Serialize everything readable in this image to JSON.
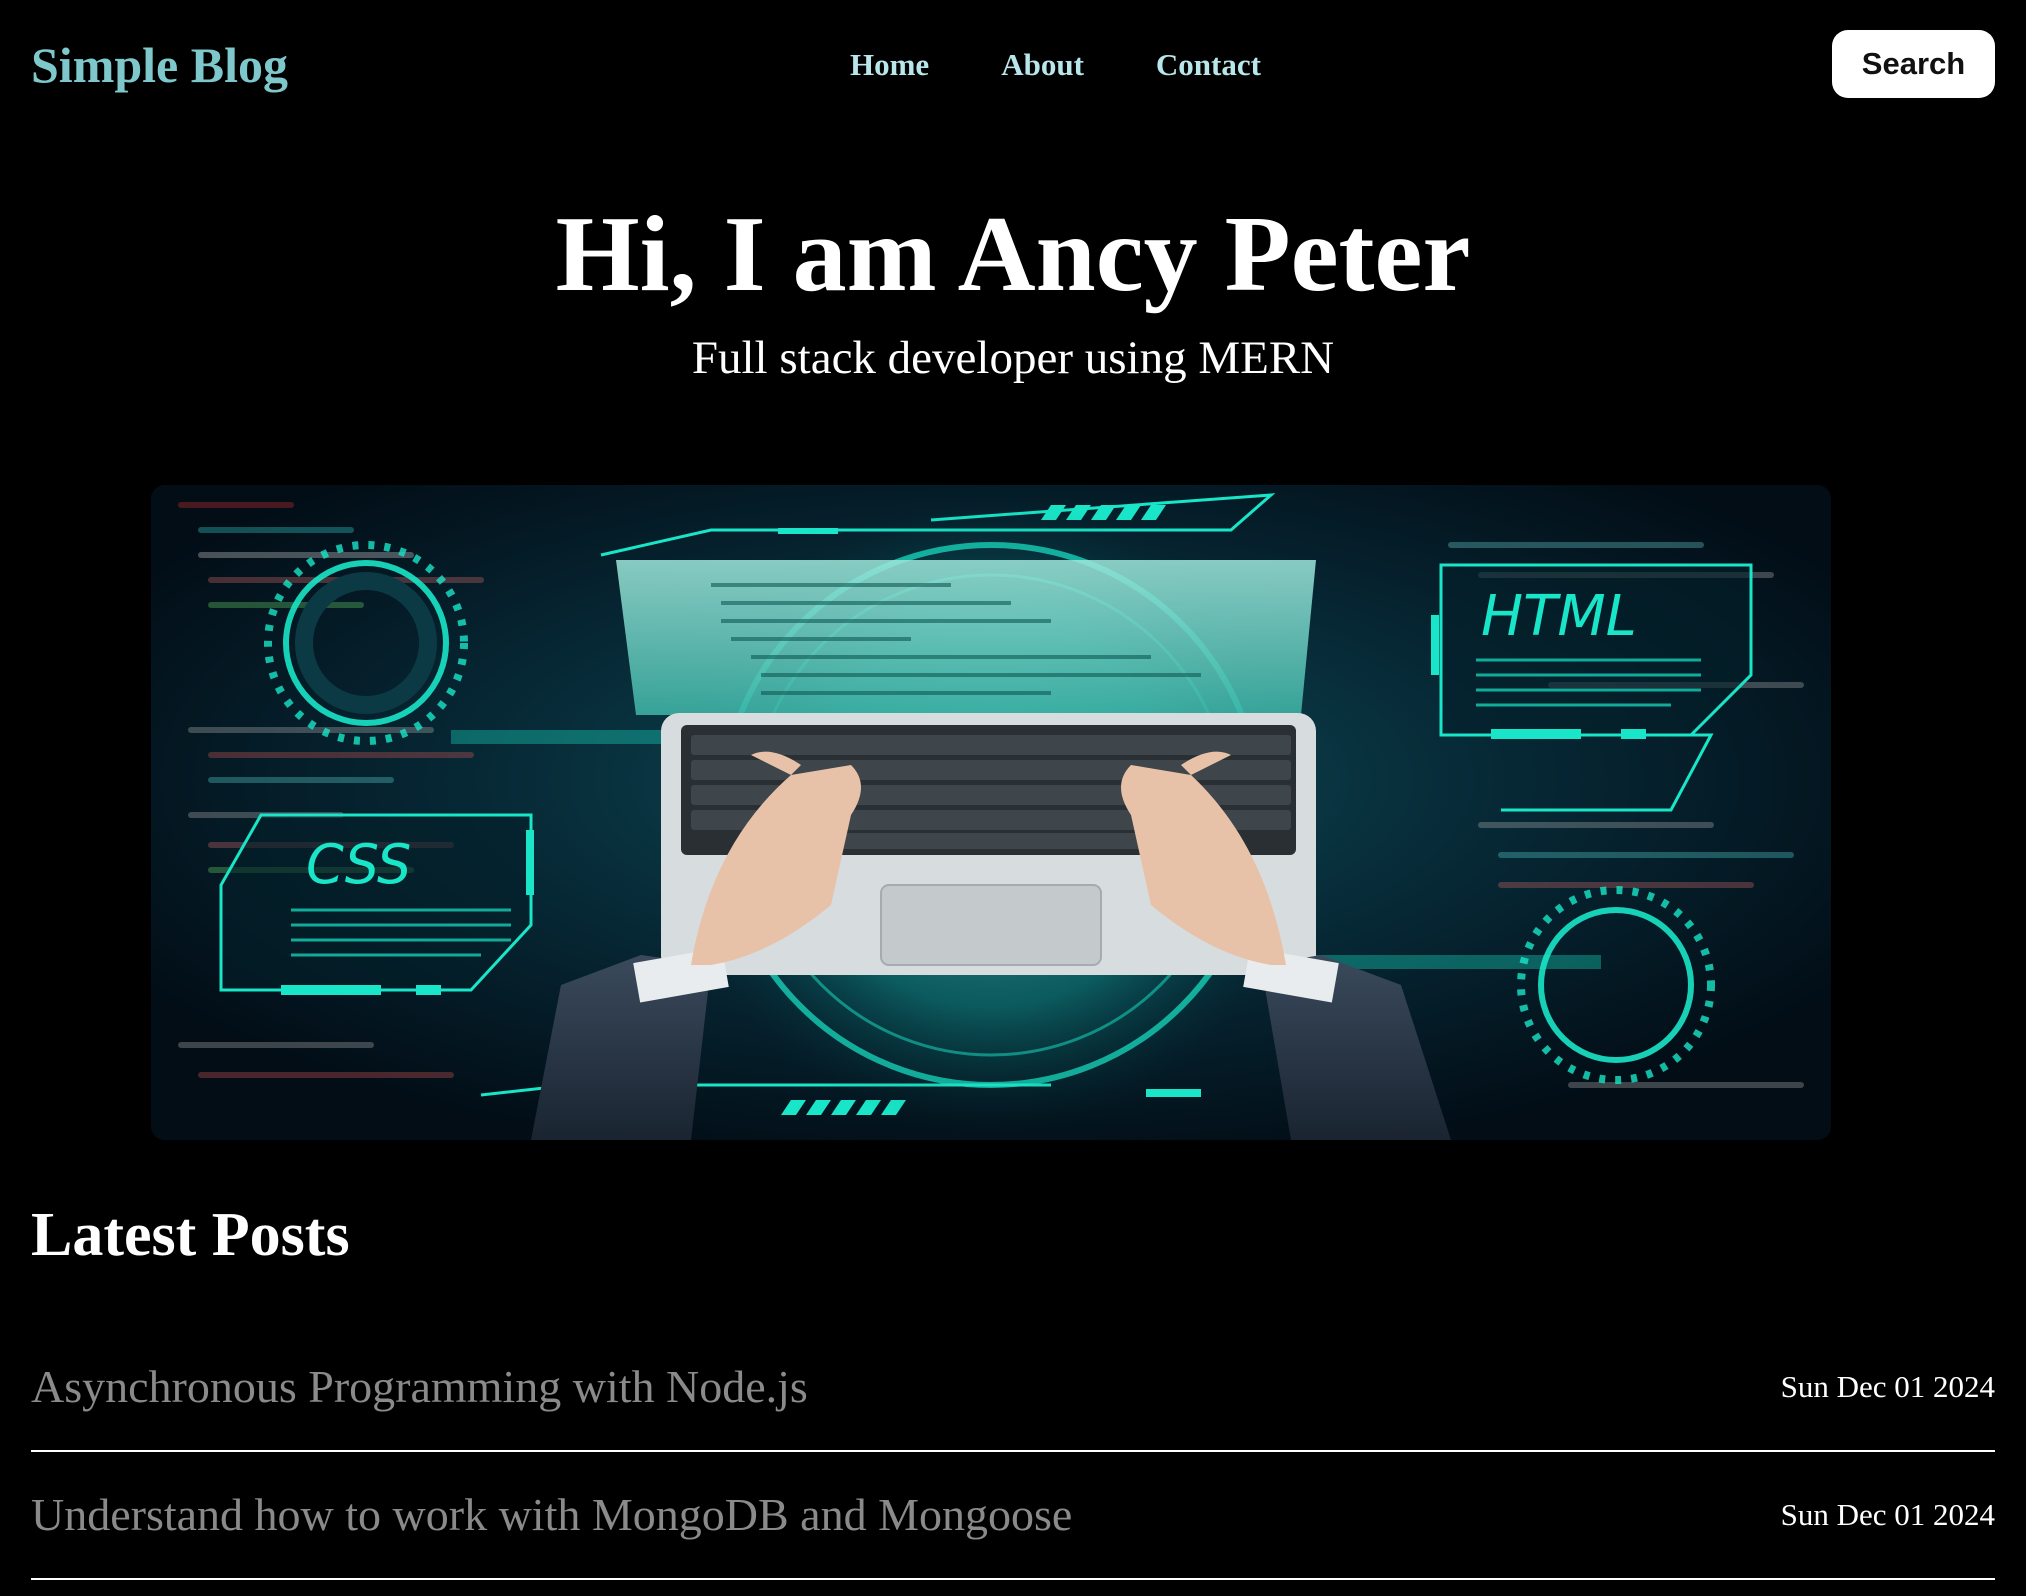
{
  "header": {
    "logo": "Simple Blog",
    "nav": [
      {
        "label": "Home"
      },
      {
        "label": "About"
      },
      {
        "label": "Contact"
      }
    ],
    "search_label": "Search"
  },
  "hero": {
    "title": "Hi, I am Ancy Peter",
    "subtitle": "Full stack developer using MERN",
    "image": {
      "html_label": "HTML",
      "css_label": "CSS"
    }
  },
  "posts": {
    "heading": "Latest Posts",
    "items": [
      {
        "title": "Asynchronous Programming with Node.js",
        "date": "Sun Dec 01 2024"
      },
      {
        "title": "Understand how to work with MongoDB and Mongoose",
        "date": "Sun Dec 01 2024"
      }
    ]
  },
  "colors": {
    "background": "#000000",
    "logo": "#7ec8cc",
    "nav": "#b8e6ea",
    "accent": "#19e6c8",
    "post_title": "#8a8a8a"
  }
}
